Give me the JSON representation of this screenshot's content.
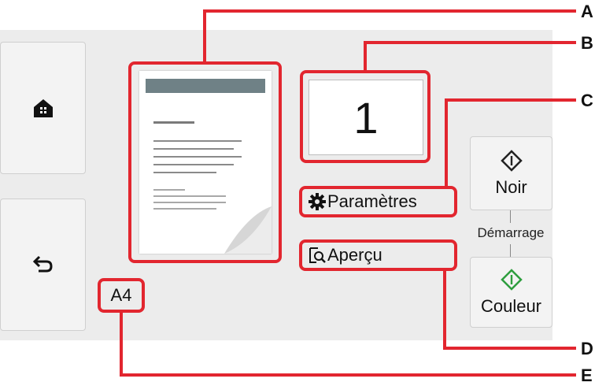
{
  "callouts": [
    "A",
    "B",
    "C",
    "D",
    "E"
  ],
  "copy_count": "1",
  "settings_label": "Paramètres",
  "preview_label": "Aperçu",
  "start": {
    "black_label": "Noir",
    "group_label": "Démarrage",
    "color_label": "Couleur"
  },
  "paper_size": "A4",
  "icons": {
    "home": "home-icon",
    "back": "back-arrow-icon",
    "settings": "gear-icon",
    "preview": "preview-magnifier-icon",
    "start": "start-diamond-icon"
  },
  "colors": {
    "highlight": "#e2262f",
    "start_black": "#222222",
    "start_color": "#2e9e3e"
  }
}
